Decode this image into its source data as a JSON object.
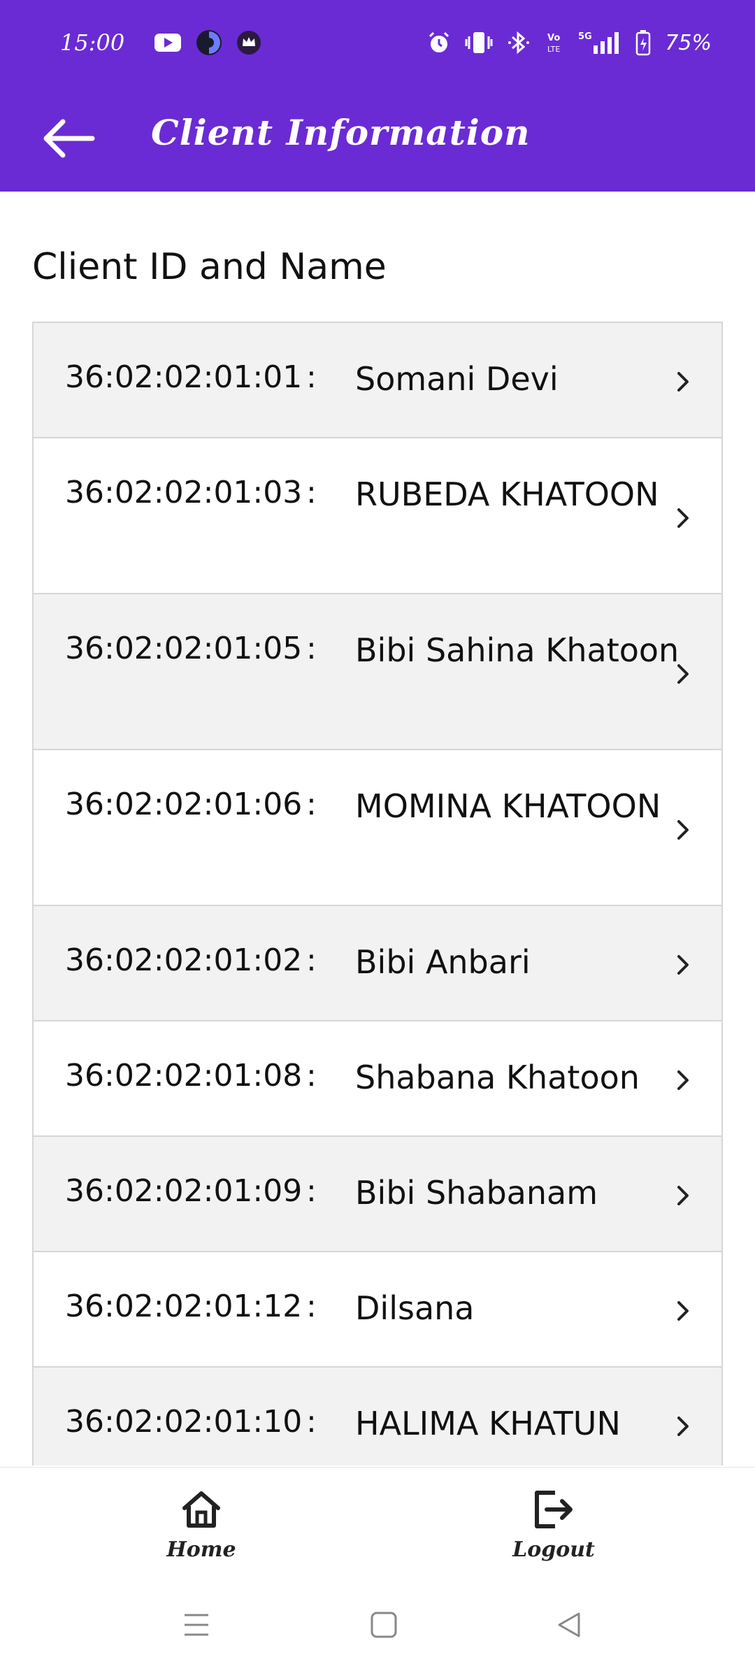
{
  "status_bar": {
    "time": "15:00",
    "battery": "75%",
    "icons": [
      "youtube-icon",
      "app-icon",
      "crown-icon",
      "alarm-icon",
      "vibrate-icon",
      "bluetooth-icon",
      "volte-icon",
      "5g-signal-icon",
      "battery-icon"
    ]
  },
  "app_bar": {
    "title": "Client Information",
    "back_icon": "arrow-left-icon"
  },
  "section_title": "Client ID and Name",
  "clients": [
    {
      "id": "36:02:02:01:01",
      "sep": ":",
      "name": "Somani Devi"
    },
    {
      "id": "36:02:02:01:03",
      "sep": ":",
      "name": "RUBEDA KHATOON"
    },
    {
      "id": "36:02:02:01:05",
      "sep": ":",
      "name": "Bibi Sahina Khatoon"
    },
    {
      "id": "36:02:02:01:06",
      "sep": ":",
      "name": "MOMINA KHATOON"
    },
    {
      "id": "36:02:02:01:02",
      "sep": ":",
      "name": "Bibi Anbari"
    },
    {
      "id": "36:02:02:01:08",
      "sep": ":",
      "name": "Shabana Khatoon"
    },
    {
      "id": "36:02:02:01:09",
      "sep": ":",
      "name": "Bibi Shabanam"
    },
    {
      "id": "36:02:02:01:12",
      "sep": ":",
      "name": "Dilsana"
    },
    {
      "id": "36:02:02:01:10",
      "sep": ":",
      "name": "HALIMA KHATUN"
    }
  ],
  "bottom_nav": {
    "home_label": "Home",
    "logout_label": "Logout"
  },
  "colors": {
    "primary": "#6a2bd4",
    "row_alt": "#f2f2f2",
    "divider": "#d6d6d6"
  }
}
